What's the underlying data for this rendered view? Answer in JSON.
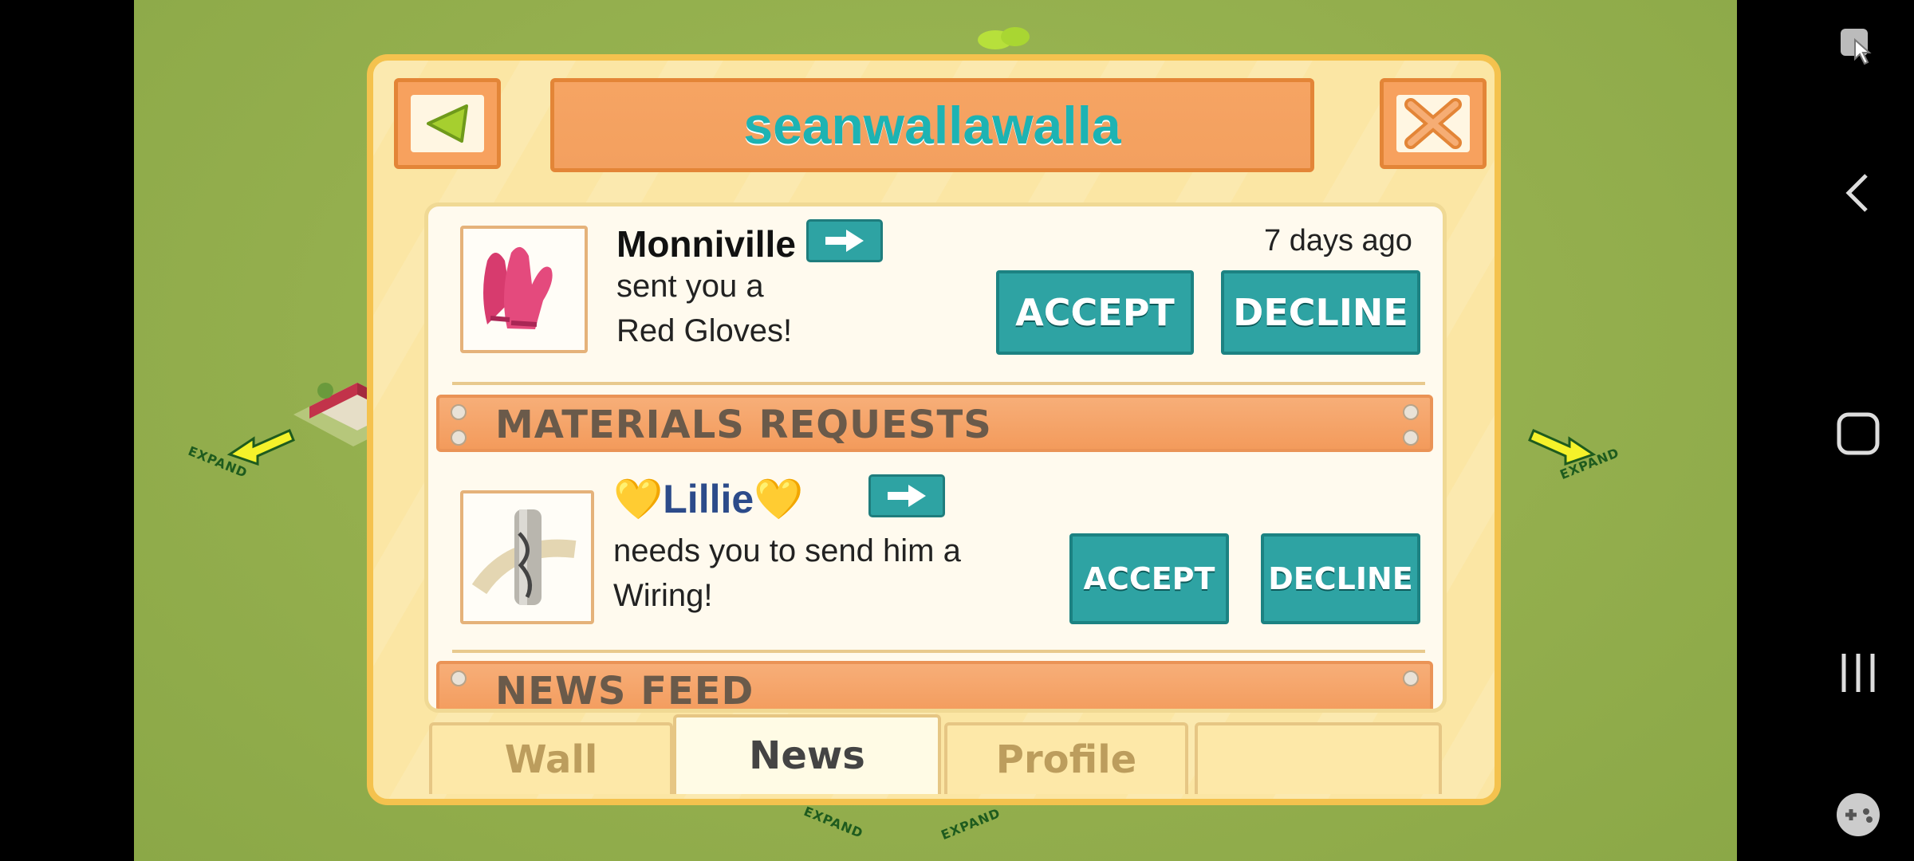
{
  "dialog": {
    "title": "seanwallawalla",
    "back_button_icon": "triangle-left-icon",
    "close_button_icon": "x-icon"
  },
  "requests": [
    {
      "sender": "Monniville",
      "time": "7 days ago",
      "line1": "sent you a",
      "line2": "Red Gloves!",
      "item_icon": "red-gloves-icon",
      "accept_label": "ACCEPT",
      "decline_label": "DECLINE"
    }
  ],
  "materials_section": {
    "title": "MATERIALS REQUESTS",
    "items": [
      {
        "sender_heart_left": "💛",
        "sender": "Lillie",
        "sender_heart_right": "💛",
        "line1": "needs you to send him a",
        "line2": "Wiring!",
        "item_icon": "wiring-icon",
        "accept_label": "ACCEPT",
        "decline_label": "DECLINE"
      }
    ]
  },
  "news_section": {
    "title": "NEWS FEED"
  },
  "tabs": [
    {
      "label": "Wall",
      "active": false
    },
    {
      "label": "News",
      "active": true
    },
    {
      "label": "Profile",
      "active": false
    },
    {
      "label": "",
      "active": false
    }
  ],
  "background": {
    "expand_labels": [
      "EXPAND",
      "EXPAND",
      "EXPAND",
      "EXPAND"
    ]
  },
  "system_nav": [
    "screenshot-touch-icon",
    "back-icon",
    "home-icon",
    "recents-icon",
    "game-tools-icon"
  ],
  "colors": {
    "teal": "#2ea3a3",
    "orange": "#f39b5c",
    "panel": "#fffaee",
    "frame": "#f4c24e",
    "grass": "#95b24f"
  }
}
